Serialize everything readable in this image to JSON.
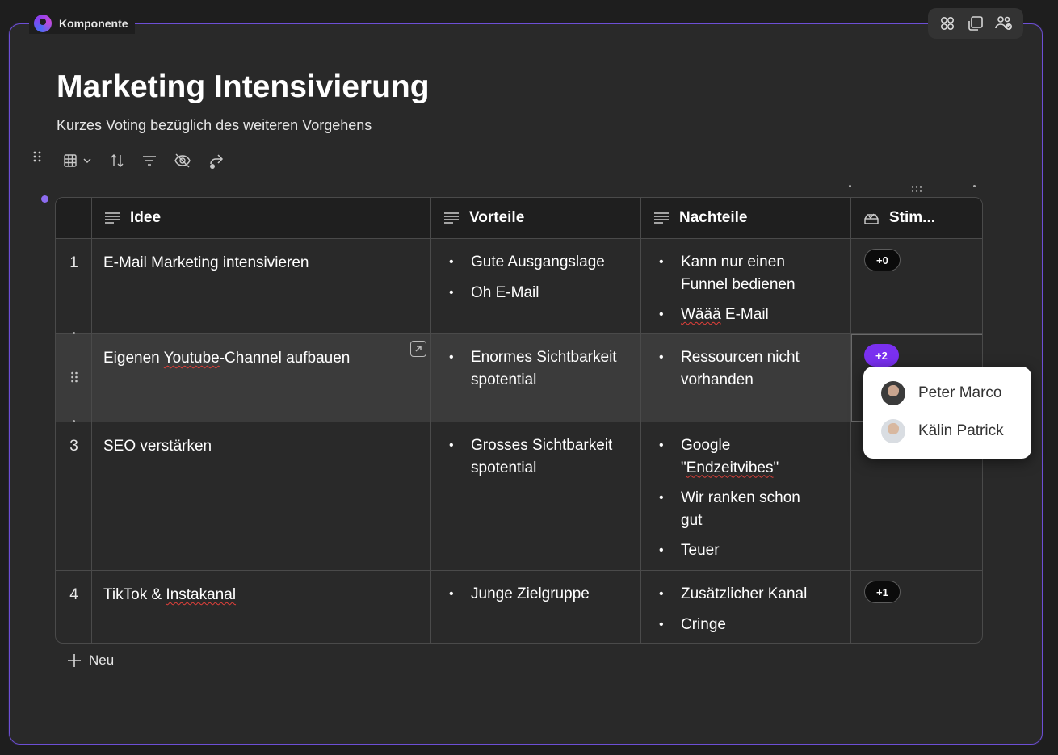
{
  "frame": {
    "label": "Komponente"
  },
  "top_tools": [
    {
      "icon": "apps-icon"
    },
    {
      "icon": "copy-component-icon"
    },
    {
      "icon": "share-people-icon"
    }
  ],
  "page": {
    "title": "Marketing Intensivierung",
    "subtitle": "Kurzes Voting bezüglich des weiteren Vorgehens"
  },
  "toolbar": [
    {
      "icon": "table-view-icon"
    },
    {
      "icon": "sort-icon"
    },
    {
      "icon": "filter-icon"
    },
    {
      "icon": "hide-icon"
    },
    {
      "icon": "share-icon"
    }
  ],
  "table": {
    "columns": [
      {
        "label": "Idee",
        "icon": "text-column-icon"
      },
      {
        "label": "Vorteile",
        "icon": "text-column-icon"
      },
      {
        "label": "Nachteile",
        "icon": "text-column-icon"
      },
      {
        "label": "Stim...",
        "icon": "vote-column-icon"
      }
    ],
    "rows": [
      {
        "num": "1",
        "idee": "E-Mail Marketing intensivieren",
        "vorteile": [
          "Gute Ausgangslage",
          "Oh E-Mail"
        ],
        "nachteile": [
          "Kann nur einen Funnel bedienen",
          "Wäää E-Mail"
        ],
        "votes": "+0"
      },
      {
        "num": "",
        "idee_a": "Eigenen ",
        "idee_b": "Youtube",
        "idee_c": "-Channel aufbauen",
        "vorteile": [
          "Enormes Sichtbarkeitspotential"
        ],
        "nachteile": [
          "Ressourcen nicht vorhanden"
        ],
        "votes": "+2"
      },
      {
        "num": "3",
        "idee": "SEO verstärken",
        "vorteile": [
          "Grosses Sichtbarkeitspotential"
        ],
        "nachteile_1a": "Google \"",
        "nachteile_1b": "Endzeitvibes",
        "nachteile_1c": "\"",
        "nachteile": [
          "Wir ranken schon gut",
          "Teuer"
        ],
        "votes": ""
      },
      {
        "num": "4",
        "idee_a": "TikTok & ",
        "idee_b": "Instakanal",
        "vorteile": [
          "Junge Zielgruppe"
        ],
        "nachteile": [
          "Zusätzlicher Kanal",
          "Cringe"
        ],
        "votes": "+1"
      }
    ]
  },
  "new_row_label": "Neu",
  "voters_popup": {
    "people": [
      "Peter Marco",
      "Kälin Patrick"
    ]
  }
}
